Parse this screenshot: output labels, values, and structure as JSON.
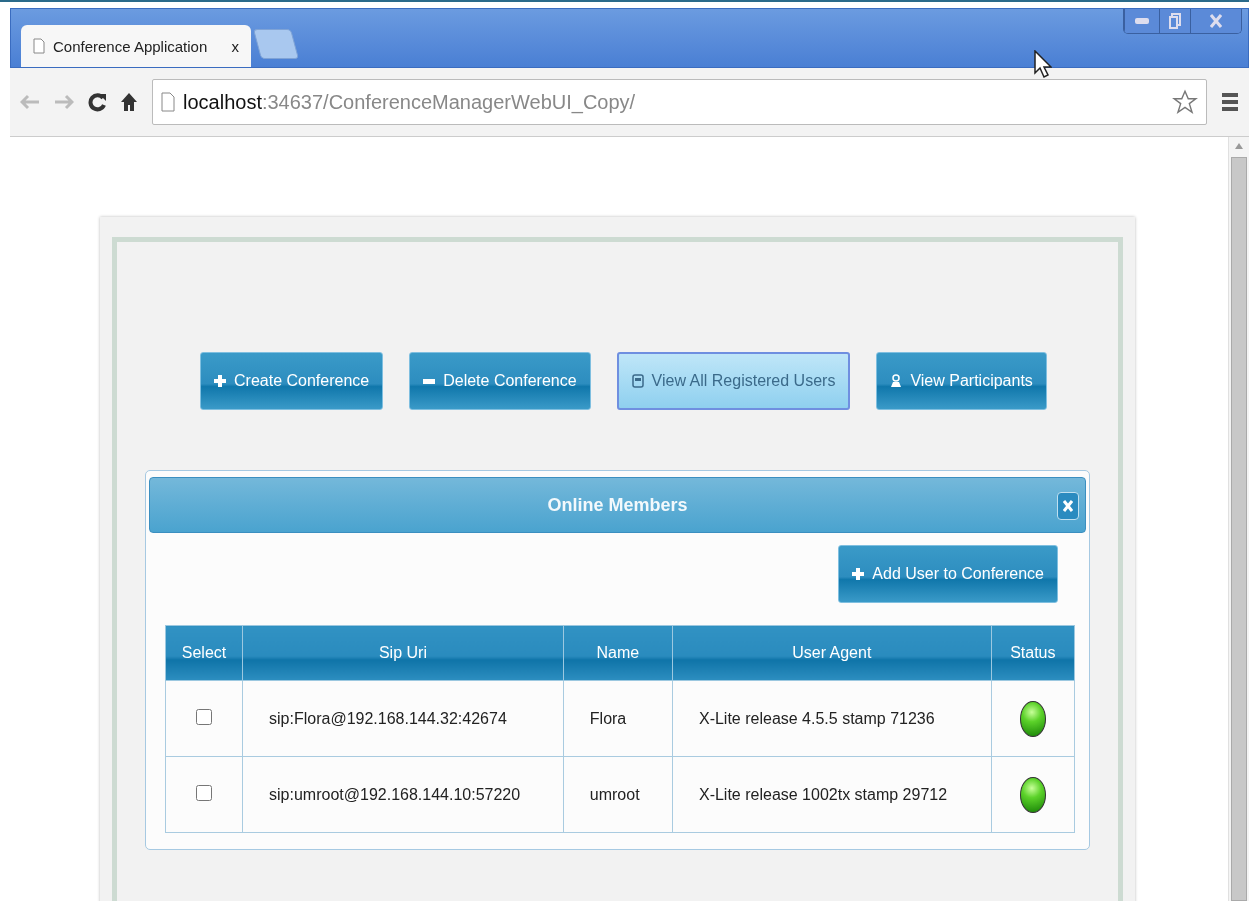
{
  "browser": {
    "tab": {
      "title": "Conference Application",
      "close": "x"
    },
    "address": {
      "host": "localhost",
      "path": ":34637/ConferenceManagerWebUI_Copy/"
    }
  },
  "toolbar": [
    {
      "label": "Create Conference",
      "kind": "add",
      "selected": false
    },
    {
      "label": "Delete Conference",
      "kind": "remove",
      "selected": false
    },
    {
      "label": "View All Registered Users",
      "kind": "list",
      "selected": true
    },
    {
      "label": "View Participants",
      "kind": "people",
      "selected": false
    }
  ],
  "panel": {
    "title": "Online Members",
    "action": "Add User to Conference",
    "table": {
      "columns": [
        "Select",
        "Sip Uri",
        "Name",
        "User Agent",
        "Status"
      ],
      "rows": [
        {
          "checked": false,
          "sip_uri": "sip:Flora@192.168.144.32:42674",
          "name": "Flora",
          "user_agent": "X-Lite release 4.5.5 stamp 71236",
          "online": true
        },
        {
          "checked": false,
          "sip_uri": "sip:umroot@192.168.144.10:57220",
          "name": "umroot",
          "user_agent": "X-Lite release 1002tx stamp 29712",
          "online": true
        }
      ]
    }
  }
}
